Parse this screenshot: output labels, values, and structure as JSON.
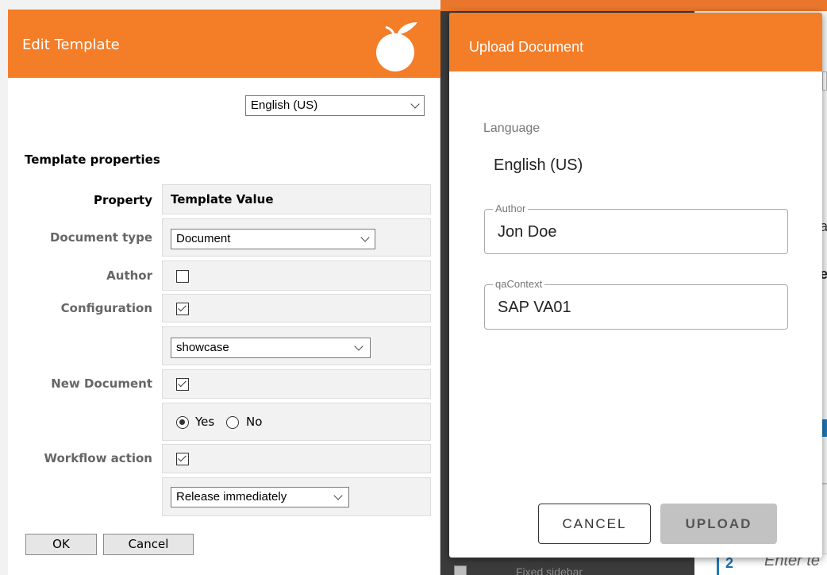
{
  "edit_template": {
    "title": "Edit Template",
    "language_select": "English (US)",
    "section_title": "Template properties",
    "table": {
      "header_property": "Property",
      "header_value": "Template Value",
      "rows": {
        "document_type": {
          "label": "Document type",
          "value": "Document"
        },
        "author": {
          "label": "Author",
          "checked": false
        },
        "configuration": {
          "label": "Configuration",
          "checked": true,
          "select_value": "showcase"
        },
        "new_document": {
          "label": "New Document",
          "checked": true,
          "radio_yes": "Yes",
          "radio_no": "No",
          "selected": "Yes"
        },
        "workflow_action": {
          "label": "Workflow action",
          "checked": true,
          "select_value": "Release immediately"
        }
      }
    },
    "ok_label": "OK",
    "cancel_label": "Cancel"
  },
  "upload_document": {
    "title": "Upload Document",
    "language_label": "Language",
    "language_value": "English (US)",
    "author_label": "Author",
    "author_value": "Jon Doe",
    "qacontext_label": "qaContext",
    "qacontext_value": "SAP VA01",
    "cancel_label": "CANCEL",
    "upload_label": "UPLOAD"
  },
  "background": {
    "step_number": "2",
    "step_placeholder": "Enter te",
    "fixed_sidebar_label": "Fixed sidebar",
    "peek_a": "a",
    "peek_b": "e"
  },
  "colors": {
    "brand_orange": "#f47d28",
    "upload_disabled": "#c2c2c2"
  }
}
